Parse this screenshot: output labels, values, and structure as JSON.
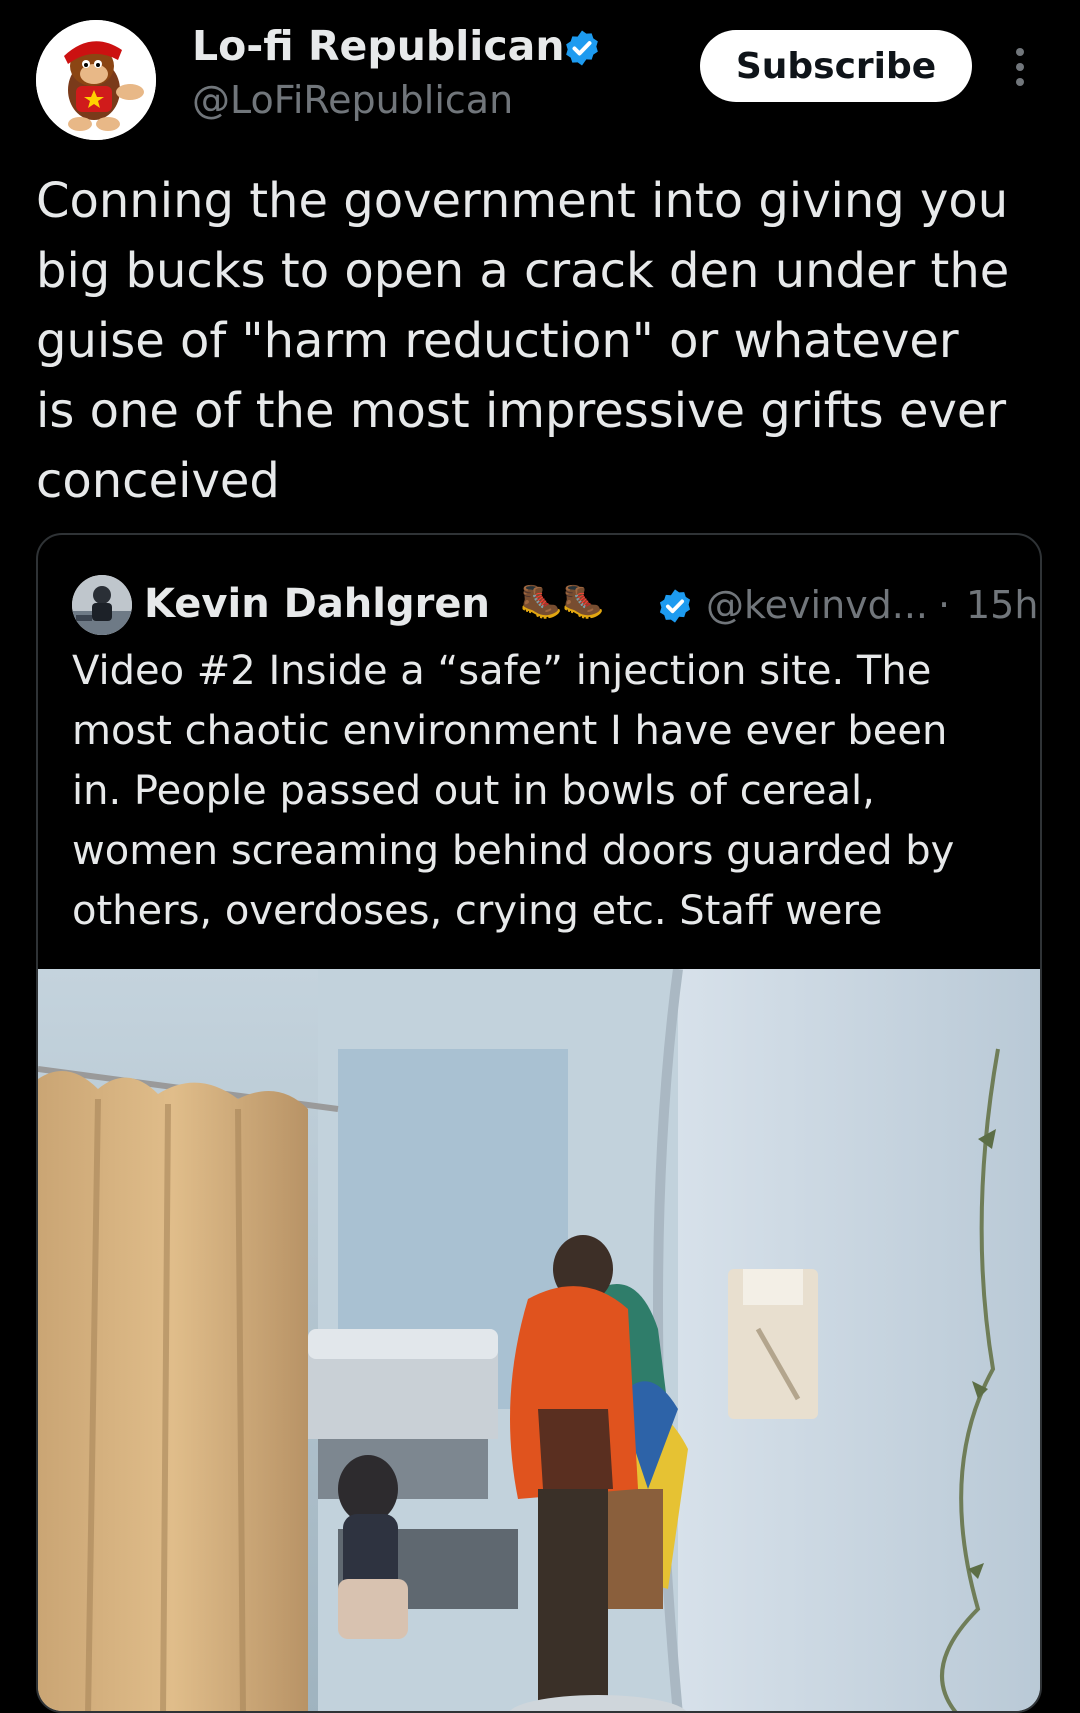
{
  "author": {
    "display_name": "Lo-fi Republican",
    "handle": "@LoFiRepublican",
    "avatar_icon": "cartoon-monkey-avatar"
  },
  "actions": {
    "subscribe_label": "Subscribe",
    "more_icon": "more-vertical-icon"
  },
  "tweet": {
    "text": "Conning the government into giving you\nbig bucks to open a crack den under the\nguise of \"harm reduction\" or whatever\nis one of the most impressive grifts ever\nconceived"
  },
  "quote": {
    "display_name": "Kevin Dahlgren",
    "emoji": "🥾🥾",
    "handle": "@kevinvd...",
    "separator": "·",
    "time": "15h",
    "text": "Video #2 Inside a “safe” injection site. The\nmost chaotic environment I have ever been\nin. People passed out in bowls of cereal,\nwomen screaming behind doors guarded by\nothers, overdoses, crying etc. Staff were",
    "media_alt": "video-still-injection-site"
  },
  "colors": {
    "background": "#000000",
    "text": "#e7e9ea",
    "secondary": "#71767b",
    "verified": "#1d9bf0",
    "border": "#2f3336"
  }
}
